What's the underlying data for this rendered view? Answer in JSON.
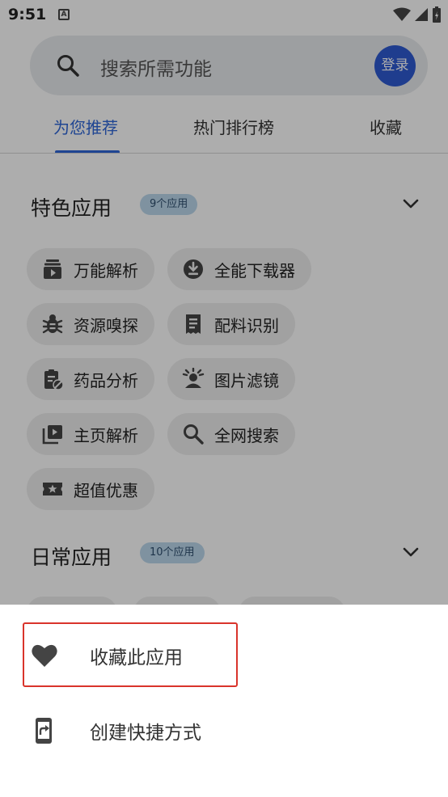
{
  "status_bar": {
    "time": "9:51",
    "notification_icon": "A"
  },
  "search": {
    "placeholder": "搜索所需功能",
    "login_label": "登录"
  },
  "tabs": [
    {
      "label": "为您推荐",
      "active": true
    },
    {
      "label": "热门排行榜",
      "active": false
    },
    {
      "label": "收藏",
      "active": false
    }
  ],
  "featured": {
    "title": "特色应用",
    "badge": "9个应用",
    "apps": [
      {
        "label": "万能解析",
        "icon": "play-box-icon"
      },
      {
        "label": "全能下载器",
        "icon": "download-circle-icon"
      },
      {
        "label": "资源嗅探",
        "icon": "bug-icon"
      },
      {
        "label": "配料识别",
        "icon": "receipt-icon"
      },
      {
        "label": "药品分析",
        "icon": "clipboard-pill-icon"
      },
      {
        "label": "图片滤镜",
        "icon": "portrait-filter-icon"
      },
      {
        "label": "主页解析",
        "icon": "video-library-icon"
      },
      {
        "label": "全网搜索",
        "icon": "search-icon"
      },
      {
        "label": "超值优惠",
        "icon": "ticket-star-icon"
      }
    ]
  },
  "daily": {
    "title": "日常应用",
    "badge": "10个应用"
  },
  "sheet": {
    "items": [
      {
        "label": "收藏此应用",
        "icon": "heart-icon"
      },
      {
        "label": "创建快捷方式",
        "icon": "shortcut-icon"
      }
    ]
  },
  "colors": {
    "accent": "#2f66d8",
    "login_bg": "#2f5bd1",
    "highlight": "#d9342b",
    "badge_bg": "#bcd8ec"
  }
}
